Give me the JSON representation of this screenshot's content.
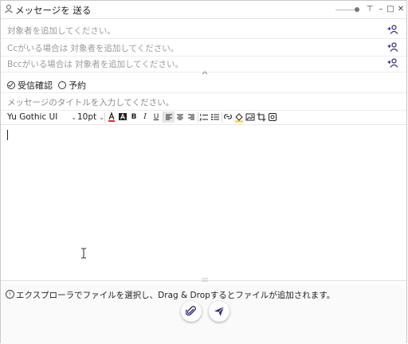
{
  "window": {
    "title": "メッセージを 送る"
  },
  "titlebar": {
    "pin": "⊤",
    "min": "–",
    "max": "□",
    "close": "✕"
  },
  "recipients": {
    "to_placeholder": "対象者を追加してください。",
    "cc_placeholder": "Ccがいる場合は 対象者を追加してください。",
    "bcc_placeholder": "Bccがいる場合は 対象者を追加してください。"
  },
  "options": {
    "receipt_label": "受信確認",
    "receipt_checked": true,
    "schedule_label": "予約",
    "schedule_checked": false
  },
  "subject": {
    "placeholder": "メッセージのタイトルを入力してください。"
  },
  "toolbar": {
    "font": "Yu Gothic UI",
    "size": "10pt"
  },
  "footer": {
    "info_text": "エクスプローラでファイルを選択し、Drag & Dropするとファイルが追加されます。"
  },
  "colors": {
    "accent": "#3b2a7a",
    "font_color_bar": "#d0312d",
    "highlight_bar": "#f5d000"
  }
}
